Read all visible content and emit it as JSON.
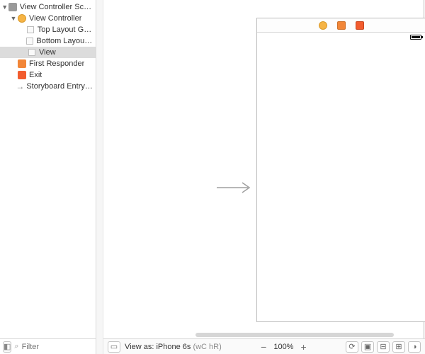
{
  "outline": {
    "scene": "View Controller Scene",
    "vc": "View Controller",
    "topLayout": "Top Layout Guide",
    "bottomLayout": "Bottom Layout G…",
    "view": "View",
    "firstResponder": "First Responder",
    "exit": "Exit",
    "entry": "Storyboard Entry Poi…"
  },
  "filter": {
    "placeholder": "Filter"
  },
  "bottom": {
    "viewAsLabel": "View as:",
    "viewAsDevice": "iPhone 6s",
    "viewAsTraits": "(wC hR)",
    "zoom": "100%"
  }
}
